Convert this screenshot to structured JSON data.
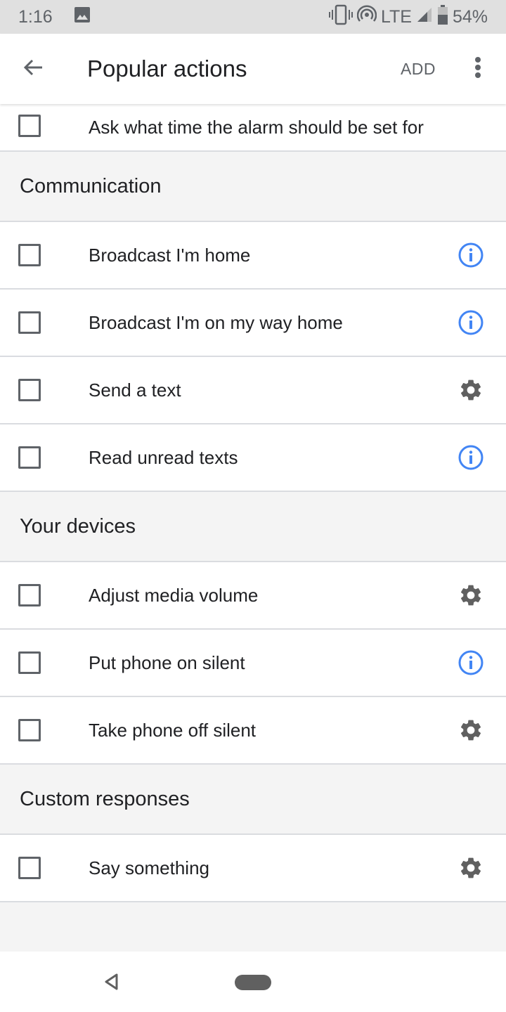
{
  "status_bar": {
    "time": "1:16",
    "network": "LTE",
    "battery": "54%",
    "icons": [
      "gallery-icon",
      "vibrate-icon",
      "hotspot-icon",
      "signal-icon",
      "battery-icon"
    ]
  },
  "app_bar": {
    "title": "Popular actions",
    "add_label": "ADD",
    "icons": [
      "back-arrow-icon",
      "more-vert-icon"
    ]
  },
  "colors": {
    "info_icon": "#4285f4",
    "gear_icon": "#606060",
    "section_bg": "#f4f4f4"
  },
  "list": {
    "top_item": {
      "label": "Ask what time the alarm should be set for",
      "checked": false
    },
    "sections": [
      {
        "title": "Communication",
        "items": [
          {
            "label": "Broadcast I'm home",
            "icon": "info-icon",
            "checked": false
          },
          {
            "label": "Broadcast I'm on my way home",
            "icon": "info-icon",
            "checked": false
          },
          {
            "label": "Send a text",
            "icon": "gear-icon",
            "checked": false
          },
          {
            "label": "Read unread texts",
            "icon": "info-icon",
            "checked": false
          }
        ]
      },
      {
        "title": "Your devices",
        "items": [
          {
            "label": "Adjust media volume",
            "icon": "gear-icon",
            "checked": false
          },
          {
            "label": "Put phone on silent",
            "icon": "info-icon",
            "checked": false
          },
          {
            "label": "Take phone off silent",
            "icon": "gear-icon",
            "checked": false
          }
        ]
      },
      {
        "title": "Custom responses",
        "items": [
          {
            "label": "Say something",
            "icon": "gear-icon",
            "checked": false
          }
        ]
      }
    ]
  },
  "nav_bar": {
    "icons": [
      "nav-back-icon",
      "nav-home-pill"
    ]
  }
}
